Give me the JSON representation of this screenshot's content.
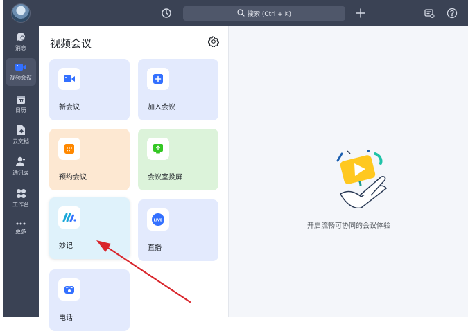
{
  "search": {
    "label": "搜索 (Ctrl + K)"
  },
  "rail": {
    "items": [
      {
        "label": "消息",
        "icon": "chat-icon"
      },
      {
        "label": "视频会议",
        "icon": "video-icon",
        "active": true
      },
      {
        "label": "日历",
        "icon": "calendar-icon"
      },
      {
        "label": "云文档",
        "icon": "doc-icon"
      },
      {
        "label": "通讯录",
        "icon": "contacts-icon"
      },
      {
        "label": "工作台",
        "icon": "workspace-icon"
      },
      {
        "label": "更多",
        "icon": "more-icon"
      }
    ]
  },
  "panel": {
    "title": "视频会议",
    "tiles": [
      {
        "label": "新会议",
        "icon": "video-camera-icon"
      },
      {
        "label": "加入会议",
        "icon": "plus-icon"
      },
      {
        "label": "预约会议",
        "icon": "schedule-icon"
      },
      {
        "label": "会议室投屏",
        "icon": "screen-cast-icon"
      },
      {
        "label": "妙记",
        "icon": "minutes-icon"
      },
      {
        "label": "直播",
        "icon": "live-icon",
        "badge": "LIVE"
      },
      {
        "label": "电话",
        "icon": "phone-icon"
      }
    ]
  },
  "main": {
    "empty_text": "开启流畅可协同的会议体验"
  },
  "colors": {
    "rail_bg": "#3a4254",
    "accent_blue": "#3370ff",
    "orange": "#ff8800",
    "green": "#34c724",
    "annotation_red": "#d9262c"
  }
}
